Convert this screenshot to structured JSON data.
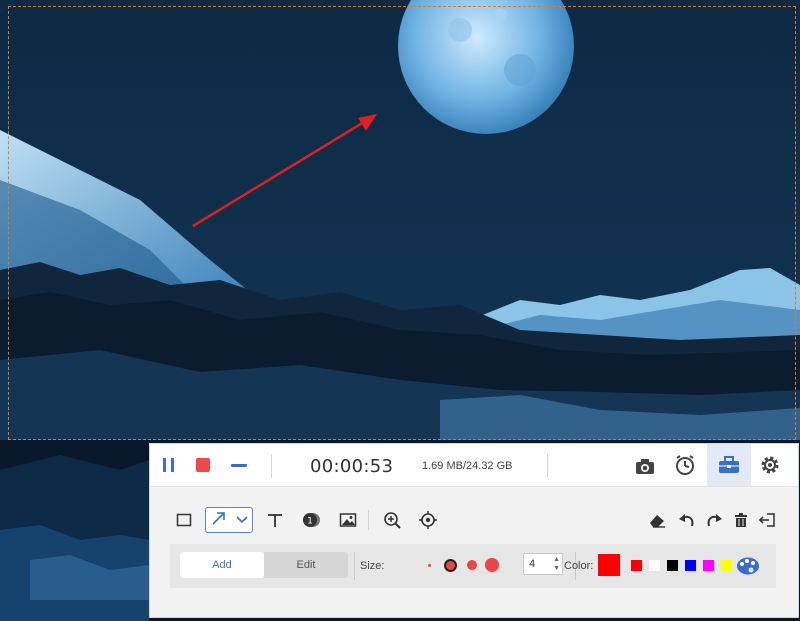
{
  "recorder": {
    "timer": "00:00:53",
    "file_size": "1.69 MB/24.32 GB",
    "buttons": {
      "pause": "pause-icon",
      "stop": "stop-icon",
      "minimize": "minimize-icon",
      "snapshot": "camera-icon",
      "schedule": "alarm-clock-icon",
      "toolbox": "toolbox-icon",
      "settings": "gear-icon"
    },
    "accent_color": "#3b6fc7",
    "stop_color": "#f04848"
  },
  "draw_tools": [
    "rectangle-icon",
    "arrow-icon",
    "text-icon",
    "callout-number-icon",
    "image-icon",
    "zoom-icon",
    "spotlight-icon",
    "eraser-icon",
    "undo-icon",
    "redo-icon",
    "delete-icon",
    "exit-icon"
  ],
  "options": {
    "add_label": "Add",
    "edit_label": "Edit",
    "size_label": "Size:",
    "size_value": "4",
    "color_label": "Color:",
    "selected_color": "#ff0000",
    "palette": [
      "#ff0000",
      "#ffffff",
      "#000000",
      "#0000ff",
      "#ff00ff",
      "#ffff00"
    ]
  }
}
